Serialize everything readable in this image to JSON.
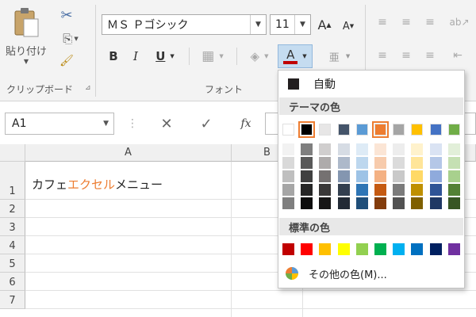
{
  "ribbon": {
    "clipboard": {
      "paste_label": "貼り付け",
      "group_label": "クリップボード"
    },
    "font": {
      "font_name": "ＭＳ Ｐゴシック",
      "font_size": "11",
      "grow_label": "A",
      "shrink_label": "A",
      "bold": "B",
      "italic": "I",
      "underline": "U",
      "font_color_label": "A",
      "furigana_label": "亜",
      "group_label": "フォント"
    }
  },
  "formula_bar": {
    "name_box": "A1",
    "fx": "fx"
  },
  "sheet": {
    "columns": [
      "A",
      "B"
    ],
    "rows": [
      "1",
      "2",
      "3",
      "4",
      "5",
      "6",
      "7"
    ],
    "a1_parts": [
      "カフェ",
      "エクセル",
      "メニュー"
    ]
  },
  "color_menu": {
    "automatic_label": "自動",
    "theme_header": "テーマの色",
    "standard_header": "標準の色",
    "more_colors_label": "その他の色(M)...",
    "theme_colors": [
      "#ffffff",
      "#000000",
      "#e7e6e6",
      "#44546a",
      "#5b9bd5",
      "#ed7d31",
      "#a5a5a5",
      "#ffc000",
      "#4472c4",
      "#70ad47"
    ],
    "theme_shades": [
      [
        "#f2f2f2",
        "#d9d9d9",
        "#bfbfbf",
        "#a6a6a6",
        "#7f7f7f"
      ],
      [
        "#7f7f7f",
        "#595959",
        "#404040",
        "#262626",
        "#0d0d0d"
      ],
      [
        "#d0cece",
        "#aeabab",
        "#757171",
        "#3a3838",
        "#171616"
      ],
      [
        "#d6dce4",
        "#adb9ca",
        "#8496b0",
        "#333f4f",
        "#222a35"
      ],
      [
        "#deebf6",
        "#bdd7ee",
        "#9dc3e6",
        "#2e75b5",
        "#1f4e79"
      ],
      [
        "#fbe5d5",
        "#f7cbac",
        "#f4b183",
        "#c55a11",
        "#833c0b"
      ],
      [
        "#ededed",
        "#dbdbdb",
        "#c9c9c9",
        "#7b7b7b",
        "#525252"
      ],
      [
        "#fff2cc",
        "#ffe599",
        "#ffd966",
        "#bf9000",
        "#7f6000"
      ],
      [
        "#dae3f3",
        "#b4c7e7",
        "#8faadc",
        "#2f5496",
        "#1f3864"
      ],
      [
        "#e2efd9",
        "#c5e0b3",
        "#a8d08d",
        "#538135",
        "#375623"
      ]
    ],
    "standard_colors": [
      "#c00000",
      "#ff0000",
      "#ffc000",
      "#ffff00",
      "#92d050",
      "#00b050",
      "#00b0f0",
      "#0070c0",
      "#002060",
      "#7030a0"
    ],
    "accent_orange": "#ed7d31"
  }
}
